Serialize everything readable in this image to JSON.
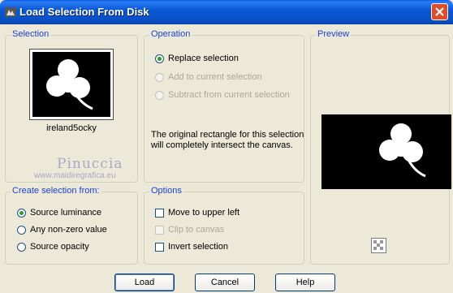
{
  "window": {
    "title": "Load Selection From Disk"
  },
  "selection": {
    "group_label": "Selection",
    "thumbnail_name": "ireland5ocky",
    "watermark_name": "Pinuccia",
    "watermark_url": "www.maidiregrafica.eu"
  },
  "operation": {
    "group_label": "Operation",
    "options": [
      {
        "label": "Replace selection",
        "selected": true,
        "enabled": true
      },
      {
        "label": "Add to current selection",
        "selected": false,
        "enabled": false
      },
      {
        "label": "Subtract from current selection",
        "selected": false,
        "enabled": false
      }
    ],
    "info_text": "The original rectangle for this selection will completely intersect the canvas."
  },
  "preview": {
    "group_label": "Preview"
  },
  "create_from": {
    "group_label": "Create selection from:",
    "options": [
      {
        "label": "Source luminance",
        "selected": true
      },
      {
        "label": "Any non-zero value",
        "selected": false
      },
      {
        "label": "Source opacity",
        "selected": false
      }
    ]
  },
  "options": {
    "group_label": "Options",
    "items": [
      {
        "label": "Move to upper left",
        "checked": false,
        "enabled": true
      },
      {
        "label": "Clip to canvas",
        "checked": false,
        "enabled": false
      },
      {
        "label": "Invert selection",
        "checked": false,
        "enabled": true
      }
    ]
  },
  "buttons": {
    "load": "Load",
    "cancel": "Cancel",
    "help": "Help"
  },
  "icons": {
    "title": "app-icon",
    "close": "close-icon",
    "zoom": "checker-zoom-icon"
  }
}
